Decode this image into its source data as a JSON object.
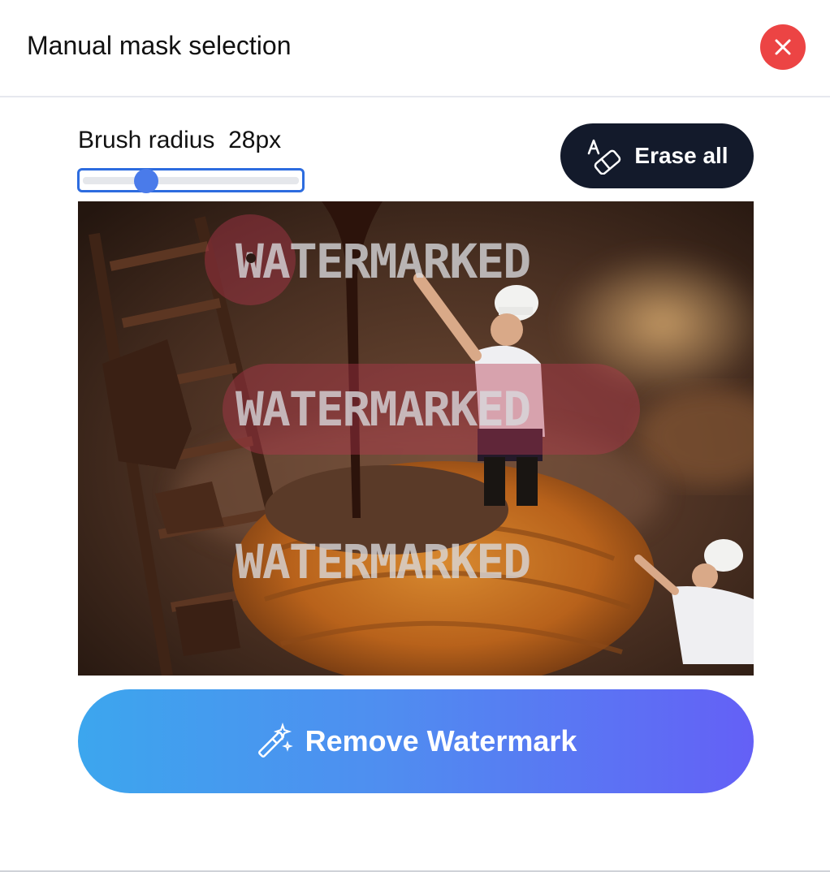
{
  "dialog": {
    "title": "Manual mask selection"
  },
  "brush": {
    "label": "Brush radius",
    "value_text": "28px",
    "slider_fraction": 0.3
  },
  "toolbar": {
    "erase_all_label": "Erase all",
    "erase_icon": "eraser-icon"
  },
  "image": {
    "watermark_texts": [
      "WATERMARKED",
      "WATERMARKED",
      "WATERMARKED"
    ]
  },
  "actions": {
    "remove_label": "Remove Watermark",
    "remove_icon": "magic-wand-icon"
  },
  "colors": {
    "close_button": "#ec4444",
    "erase_button": "#131a2b",
    "gradient_start": "#3ca6ee",
    "gradient_end": "#6460f6",
    "slider_accent": "#4a7bea",
    "mask": "#b4384f"
  }
}
